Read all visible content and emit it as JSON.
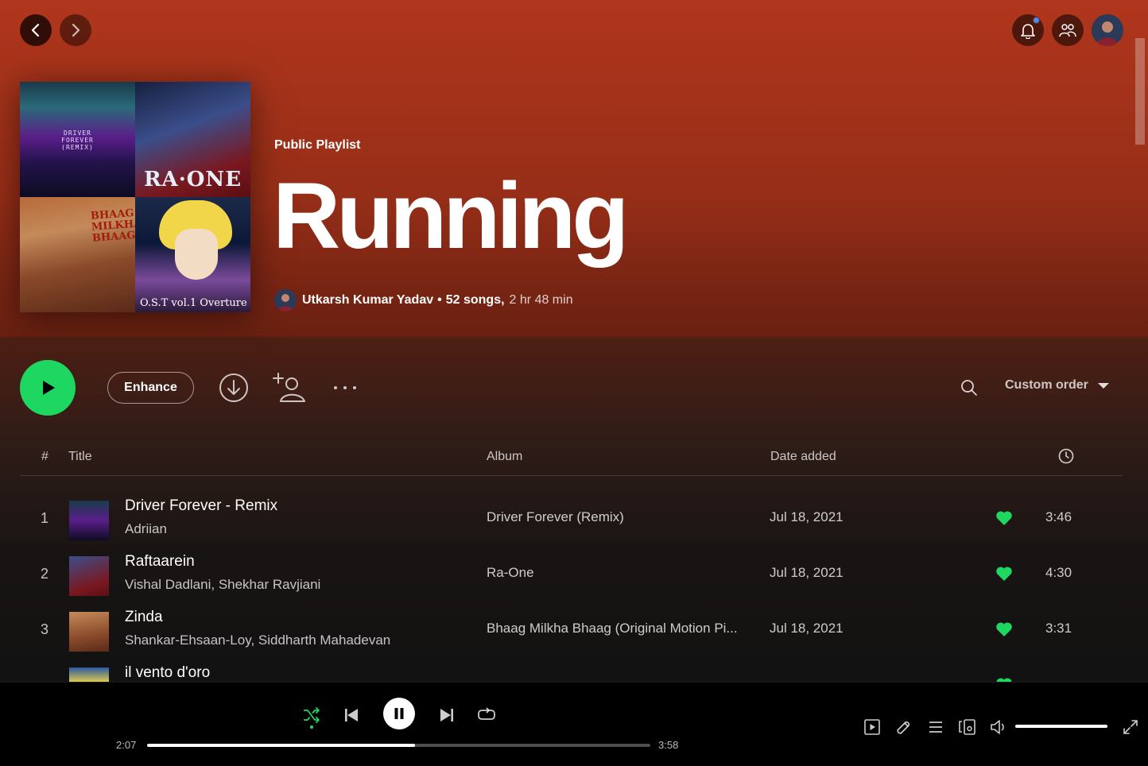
{
  "header": {
    "playlist_type": "Public Playlist",
    "playlist_title": "Running",
    "owner": "Utkarsh Kumar Yadav",
    "separator": "•",
    "song_count": "52 songs,",
    "duration": "2 hr 48 min",
    "cover_tiles": [
      "DRIVER\nFOREVER\n(REMIX)",
      "RA·ONE",
      "BHAAG\nMILKHA\nBHAAG",
      "O.S.T vol.1 Overture"
    ]
  },
  "actions": {
    "enhance_label": "Enhance",
    "sort_label": "Custom order"
  },
  "table": {
    "headers": {
      "num": "#",
      "title": "Title",
      "album": "Album",
      "date_added": "Date added"
    },
    "rows": [
      {
        "num": "1",
        "title": "Driver Forever - Remix",
        "artist": "Adriian",
        "album": "Driver Forever (Remix)",
        "date": "Jul 18, 2021",
        "duration": "3:46",
        "liked": true
      },
      {
        "num": "2",
        "title": "Raftaarein",
        "artist": "Vishal Dadlani, Shekhar Ravjiani",
        "album": "Ra-One",
        "date": "Jul 18, 2021",
        "duration": "4:30",
        "liked": true
      },
      {
        "num": "3",
        "title": "Zinda",
        "artist": "Shankar-Ehsaan-Loy, Siddharth Mahadevan",
        "album": "Bhaag Milkha Bhaag (Original Motion Pi...",
        "date": "Jul 18, 2021",
        "duration": "3:31",
        "liked": true
      },
      {
        "num": "",
        "title": "il vento d'oro",
        "artist": "",
        "album": "",
        "date": "",
        "duration": "",
        "liked": true
      }
    ]
  },
  "player": {
    "current_time": "2:07",
    "total_time": "3:58",
    "progress_fraction": 0.533,
    "volume_fraction": 1.0,
    "shuffle_active": true
  },
  "colors": {
    "accent": "#1ed760",
    "header_bg": "#b0361c",
    "notification_dot": "#3d91f4"
  },
  "icons": [
    "chevron-left-icon",
    "chevron-right-icon",
    "bell-icon",
    "friends-icon",
    "play-icon",
    "download-icon",
    "add-user-icon",
    "more-icon",
    "search-icon",
    "caret-down-icon",
    "clock-icon",
    "heart-icon",
    "shuffle-icon",
    "previous-icon",
    "pause-icon",
    "next-icon",
    "repeat-icon",
    "now-playing-view-icon",
    "lyrics-icon",
    "queue-icon",
    "connect-device-icon",
    "volume-icon",
    "fullscreen-icon"
  ]
}
